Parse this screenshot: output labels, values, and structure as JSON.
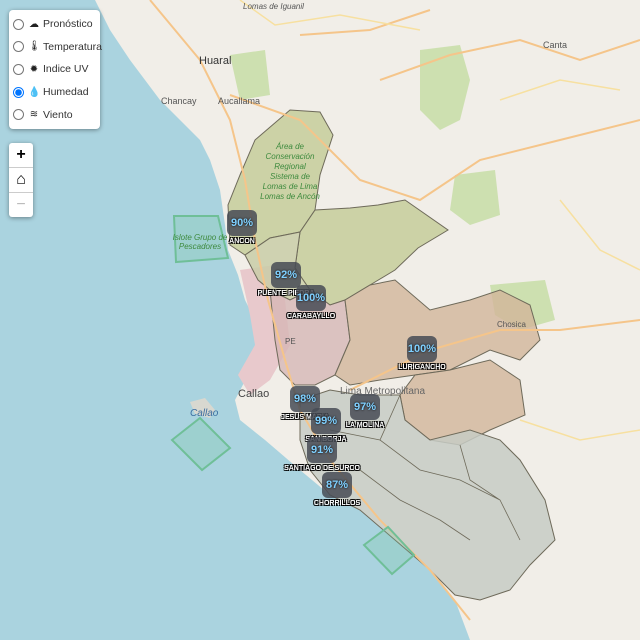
{
  "layer_control": {
    "options": [
      {
        "id": "pronostico",
        "label": "Pronóstico",
        "icon": "cloud-icon",
        "glyph": "☁",
        "checked": false
      },
      {
        "id": "temperatura",
        "label": "Temperatura",
        "icon": "thermometer-icon",
        "glyph": "🌡",
        "checked": false
      },
      {
        "id": "uv",
        "label": "Indice UV",
        "icon": "sun-icon",
        "glyph": "✹",
        "checked": false
      },
      {
        "id": "humedad",
        "label": "Humedad",
        "icon": "droplet-icon",
        "glyph": "💧",
        "checked": true
      },
      {
        "id": "viento",
        "label": "Viento",
        "icon": "wind-icon",
        "glyph": "≋",
        "checked": false
      }
    ]
  },
  "zoom_control": {
    "zoom_in": "+",
    "home": "⌂",
    "zoom_out": "−"
  },
  "map_labels": {
    "huaral": "Huaral",
    "chancay": "Chancay",
    "aucallama": "Aucallama",
    "canta": "Canta",
    "lomas_iguanil": "Lomas de Iguanil",
    "callao_city": "Callao",
    "callao_island": "Callao",
    "lima_metro": "Lima Metropolitana",
    "chosica": "Chosica",
    "pe": "PE",
    "lomas_area": "Área de Conservación Regional Sistema de Lomas de Lima Lomas de Ancón",
    "islote": "Islote Grupo de Pescadores"
  },
  "markers": [
    {
      "name": "ANCON",
      "value": "90%"
    },
    {
      "name": "PUENTE PIEDRA",
      "value": "92%"
    },
    {
      "name": "CARABAYLLO",
      "value": "100%"
    },
    {
      "name": "LURIGANCHO",
      "value": "100%"
    },
    {
      "name": "JESUS MARIA",
      "value": "98%"
    },
    {
      "name": "SAN BORJA",
      "value": "99%"
    },
    {
      "name": "LA MOLINA",
      "value": "97%"
    },
    {
      "name": "SANTIAGO DE SURCO",
      "value": "91%"
    },
    {
      "name": "CHORRILLOS",
      "value": "87%"
    }
  ]
}
